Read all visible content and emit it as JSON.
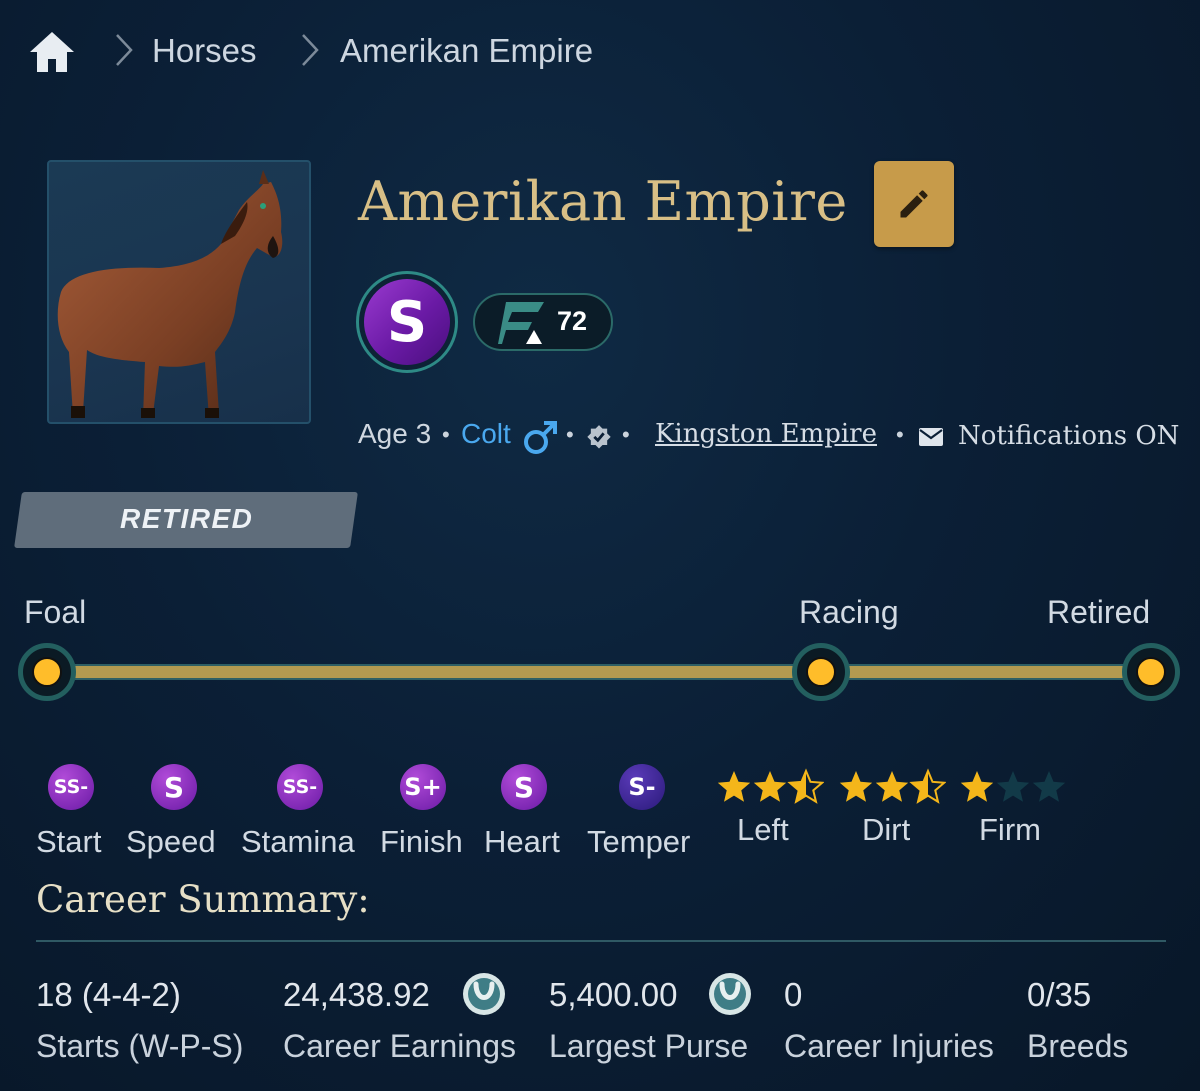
{
  "breadcrumb": {
    "home_icon": "home-icon",
    "sep": ">",
    "items": [
      "Horses",
      "Amerikan Empire"
    ]
  },
  "horse": {
    "name": "Amerikan Empire",
    "grade": "S",
    "rating": "72",
    "age": "Age 3",
    "sex": "Colt",
    "stable": "Kingston Empire",
    "notifications": "Notifications ON",
    "status": "RETIRED"
  },
  "lifecycle": {
    "stages": [
      "Foal",
      "Racing",
      "Retired"
    ]
  },
  "stats": [
    {
      "label": "Start",
      "grade": "SS-"
    },
    {
      "label": "Speed",
      "grade": "S"
    },
    {
      "label": "Stamina",
      "grade": "SS-"
    },
    {
      "label": "Finish",
      "grade": "S+"
    },
    {
      "label": "Heart",
      "grade": "S"
    },
    {
      "label": "Temper",
      "grade": "S-"
    }
  ],
  "preferences": [
    {
      "label": "Left",
      "stars": 2.5
    },
    {
      "label": "Dirt",
      "stars": 2.5
    },
    {
      "label": "Firm",
      "stars": 1
    }
  ],
  "career": {
    "title": "Career Summary:",
    "items": [
      {
        "value": "18 (4-4-2)",
        "label": "Starts (W-P-S)"
      },
      {
        "value": "24,438.92",
        "label": "Career Earnings"
      },
      {
        "value": "5,400.00",
        "label": "Largest Purse"
      },
      {
        "value": "0",
        "label": "Career Injuries"
      },
      {
        "value": "0/35",
        "label": "Breeds"
      }
    ]
  },
  "colors": {
    "accent_gold": "#d8bf86",
    "edit_button": "#c79b4a",
    "grade_purple": "#7a22b8",
    "sex_blue": "#4aa8ee",
    "star": "#f4b61a"
  }
}
